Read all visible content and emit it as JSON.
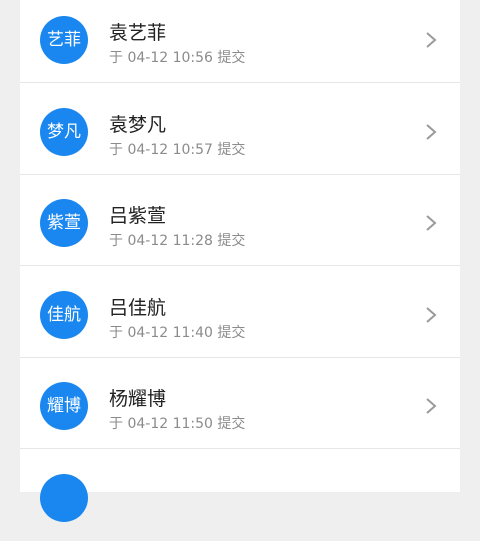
{
  "submissions": [
    {
      "avatar_text": "艺菲",
      "name": "袁艺菲",
      "time": "于 04-12 10:56 提交"
    },
    {
      "avatar_text": "梦凡",
      "name": "袁梦凡",
      "time": "于 04-12 10:57 提交"
    },
    {
      "avatar_text": "紫萱",
      "name": "吕紫萱",
      "time": "于 04-12 11:28 提交"
    },
    {
      "avatar_text": "佳航",
      "name": "吕佳航",
      "time": "于 04-12 11:40 提交"
    },
    {
      "avatar_text": "耀博",
      "name": "杨耀博",
      "time": "于 04-12 11:50 提交"
    }
  ],
  "icons": {
    "row_chevron": "chevron-right-icon"
  },
  "colors": {
    "avatar_bg": "#1a87f0",
    "page_bg": "#efefef"
  }
}
